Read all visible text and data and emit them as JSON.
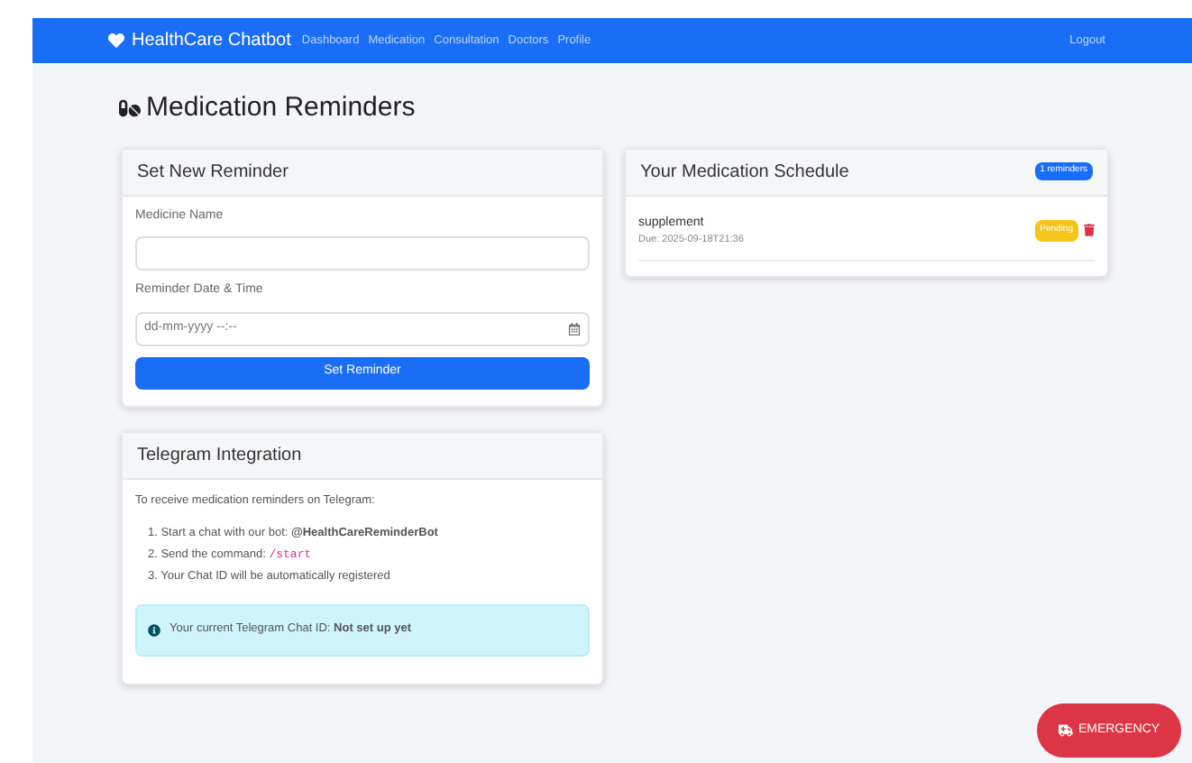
{
  "navbar": {
    "brand": "HealthCare Chatbot",
    "links": [
      {
        "label": "Dashboard"
      },
      {
        "label": "Medication"
      },
      {
        "label": "Consultation"
      },
      {
        "label": "Doctors"
      },
      {
        "label": "Profile"
      }
    ],
    "logout": "Logout"
  },
  "page_title": "Medication Reminders",
  "reminder_form": {
    "title": "Set New Reminder",
    "fields": [
      {
        "label": "Medicine Name",
        "kind": "text"
      },
      {
        "label": "Reminder Date & Time",
        "placeholder": "dd-mm-yyyy --:--",
        "kind": "datetime"
      }
    ],
    "submit": "Set Reminder"
  },
  "telegram": {
    "title": "Telegram Integration",
    "intro": "To receive medication reminders on Telegram:",
    "steps": [
      "1. Start a chat with our bot: **@HealthCareReminderBot**",
      "2. Send the command: ",
      "3. Your Chat ID will be automatically registered"
    ],
    "command": "/start",
    "notice": "Your current Telegram Chat ID: **Not set up yet**"
  },
  "schedule": {
    "title": "Your Medication Schedule",
    "badge": "1 reminders",
    "items": [
      {
        "name": "supplement",
        "due": "Due: 2025-09-18T21:36",
        "status": "Pending",
        "kind": "pending"
      }
    ]
  },
  "emergency_button": "EMERGENCY"
}
